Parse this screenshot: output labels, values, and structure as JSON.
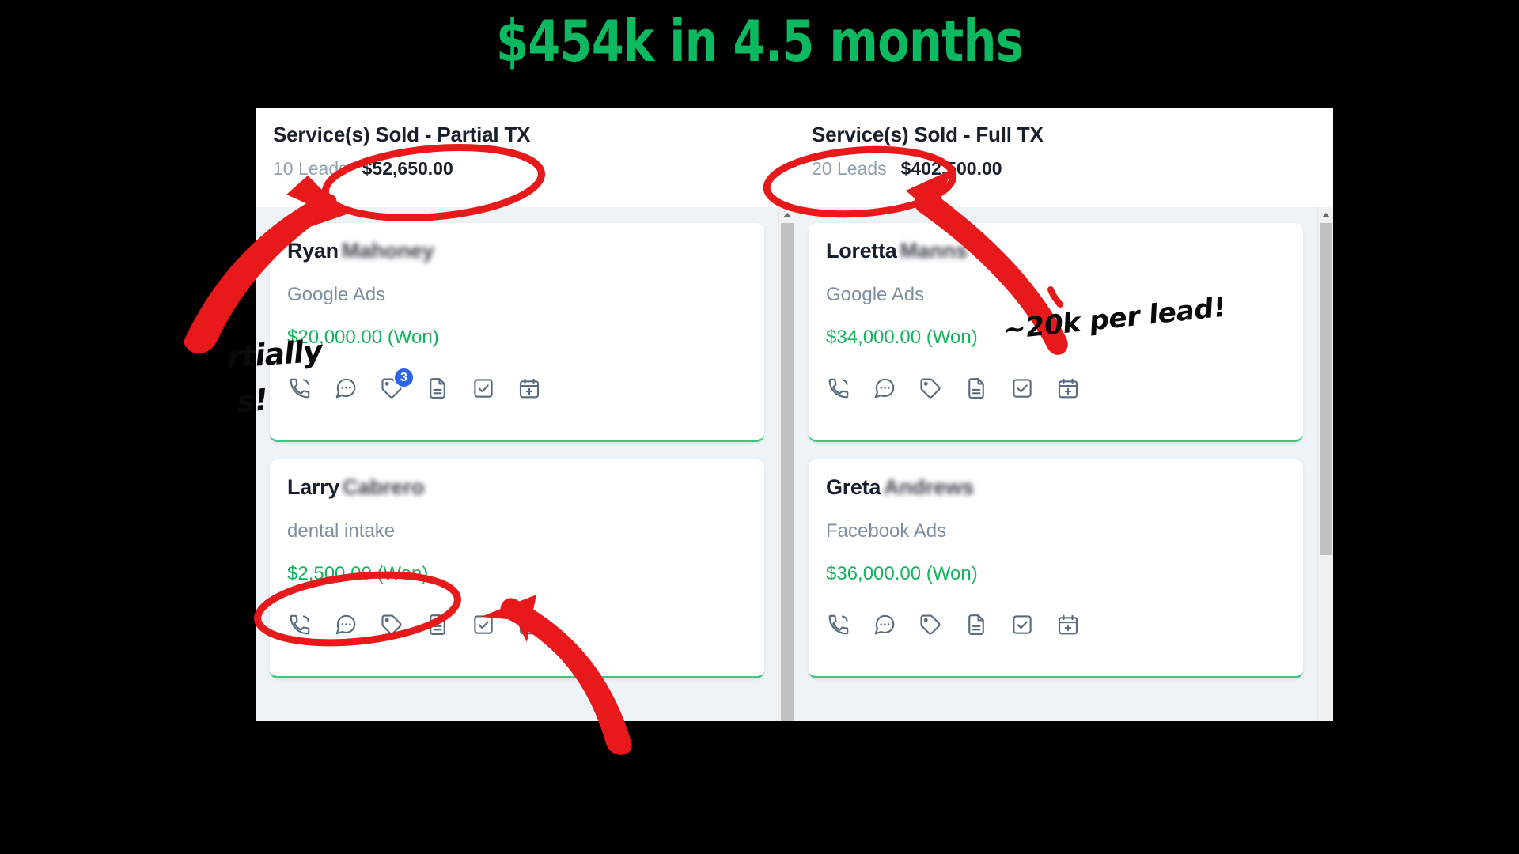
{
  "headline": "$454k in 4.5 months",
  "theme": {
    "headline_green": "#0cb961",
    "won_green": "#14b35d",
    "card_accent_green": "#39c97f",
    "badge_blue": "#2d63e8",
    "annotation_red": "#e8191b",
    "annotation_black": "#0a0a0a",
    "app_background": "#eef3f7"
  },
  "columns": [
    {
      "summary": {
        "title": "Service(s) Sold - Partial TX",
        "leads": "10 Leads",
        "amount": "$52,650.00"
      },
      "scrollbar": {
        "thumb_top_pct": 3,
        "thumb_height_pct": 97
      },
      "cards": [
        {
          "first_name": "Ryan",
          "last_name_redacted": "Mahoney",
          "source": "Google Ads",
          "value": "$20,000.00 (Won)",
          "icons": [
            {
              "name": "phone-icon",
              "badge": null
            },
            {
              "name": "chat-icon",
              "badge": null
            },
            {
              "name": "tag-icon",
              "badge": "3"
            },
            {
              "name": "document-icon",
              "badge": null
            },
            {
              "name": "task-checkbox-icon",
              "badge": null
            },
            {
              "name": "calendar-add-icon",
              "badge": null
            }
          ]
        },
        {
          "first_name": "Larry",
          "last_name_redacted": "Cabrero",
          "source": "dental intake",
          "value": "$2,500.00 (Won)",
          "icons": [
            {
              "name": "phone-icon",
              "badge": null
            },
            {
              "name": "chat-icon",
              "badge": null
            },
            {
              "name": "tag-icon",
              "badge": null
            },
            {
              "name": "document-icon",
              "badge": null
            },
            {
              "name": "task-checkbox-icon",
              "badge": null
            },
            {
              "name": "calendar-add-icon",
              "badge": null
            }
          ]
        }
      ]
    },
    {
      "summary": {
        "title": "Service(s) Sold - Full TX",
        "leads": "20 Leads",
        "amount": "$402,500.00"
      },
      "scrollbar": {
        "thumb_top_pct": 3,
        "thumb_height_pct": 65
      },
      "cards": [
        {
          "first_name": "Loretta",
          "last_name_redacted": "Manns",
          "source": "Google Ads",
          "value": "$34,000.00 (Won)",
          "icons": [
            {
              "name": "phone-icon",
              "badge": null
            },
            {
              "name": "chat-icon",
              "badge": null
            },
            {
              "name": "tag-icon",
              "badge": null
            },
            {
              "name": "document-icon",
              "badge": null
            },
            {
              "name": "task-checkbox-icon",
              "badge": null
            },
            {
              "name": "calendar-add-icon",
              "badge": null
            }
          ]
        },
        {
          "first_name": "Greta",
          "last_name_redacted": "Andrews",
          "source": "Facebook Ads",
          "value": "$36,000.00 (Won)",
          "icons": [
            {
              "name": "phone-icon",
              "badge": null
            },
            {
              "name": "chat-icon",
              "badge": null
            },
            {
              "name": "tag-icon",
              "badge": null
            },
            {
              "name": "document-icon",
              "badge": null
            },
            {
              "name": "task-checkbox-icon",
              "badge": null
            },
            {
              "name": "calendar-add-icon",
              "badge": null
            }
          ]
        }
      ]
    }
  ],
  "annotations": {
    "per_lead": "~20k per lead!",
    "partial_line1": "rtially",
    "partial_line2": "s!"
  }
}
